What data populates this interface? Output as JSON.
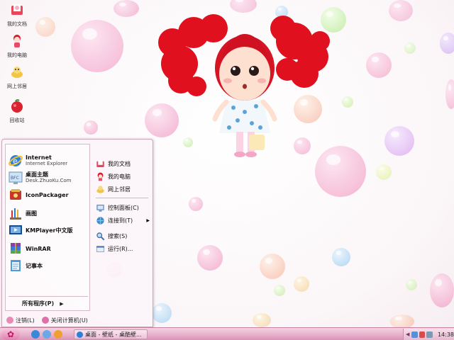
{
  "desktop": {
    "icons": [
      {
        "label": "我的文档",
        "icon": "my-documents-icon"
      },
      {
        "label": "我的电脑",
        "icon": "my-computer-icon"
      },
      {
        "label": "网上邻居",
        "icon": "network-places-icon"
      },
      {
        "label": "回收站",
        "icon": "recycle-bin-icon"
      }
    ]
  },
  "start_menu": {
    "pinned": [
      {
        "title": "Internet",
        "subtitle": "Internet Explorer",
        "icon": "internet-explorer-icon"
      },
      {
        "title": "桌面主题",
        "subtitle": "Desk.ZhuoKu.Com",
        "icon": "desktop-theme-icon"
      },
      {
        "title": "IconPackager",
        "subtitle": "",
        "icon": "iconpackager-icon"
      },
      {
        "title": "画图",
        "subtitle": "",
        "icon": "paint-icon"
      },
      {
        "title": "KMPlayer中文版",
        "subtitle": "",
        "icon": "kmplayer-icon"
      },
      {
        "title": "WinRAR",
        "subtitle": "",
        "icon": "winrar-icon"
      },
      {
        "title": "记事本",
        "subtitle": "",
        "icon": "notepad-icon"
      }
    ],
    "all_programs": "所有程序(P)",
    "right": [
      {
        "label": "我的文档",
        "icon": "my-documents-icon"
      },
      {
        "label": "我的电脑",
        "icon": "my-computer-icon"
      },
      {
        "label": "网上邻居",
        "icon": "network-places-icon"
      },
      {
        "label": "控制面板(C)",
        "icon": "control-panel-icon"
      },
      {
        "label": "连接到(T)",
        "icon": "connect-to-icon",
        "submenu": true
      },
      {
        "label": "搜索(S)",
        "icon": "search-icon"
      },
      {
        "label": "运行(R)...",
        "icon": "run-icon"
      }
    ],
    "logoff": "注销(L)",
    "shutdown": "关闭计算机(U)"
  },
  "taskbar": {
    "task_label": "桌面 - 壁纸 - 桌酷壁...",
    "clock": "14:38"
  },
  "colors": {
    "accent": "#e07fb0",
    "taskbar": "#e7b2cc"
  }
}
